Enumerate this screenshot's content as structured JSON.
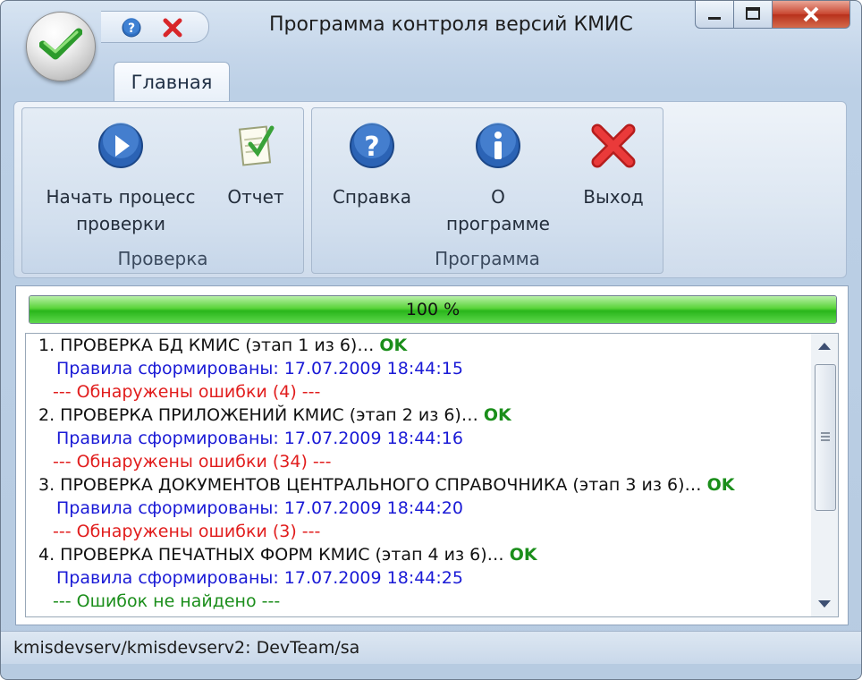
{
  "window": {
    "title": "Программа контроля версий КМИС"
  },
  "ribbon": {
    "tab_label": "Главная",
    "groups": [
      {
        "label": "Проверка",
        "buttons": [
          {
            "label": "Начать процесс\nпроверки",
            "icon": "play-icon"
          },
          {
            "label": "Отчет",
            "icon": "report-icon"
          }
        ]
      },
      {
        "label": "Программа",
        "buttons": [
          {
            "label": "Справка",
            "icon": "help-icon"
          },
          {
            "label": "О\nпрограмме",
            "icon": "info-icon"
          },
          {
            "label": "Выход",
            "icon": "exit-icon"
          }
        ]
      }
    ]
  },
  "progress": {
    "text": "100 %",
    "value": 100
  },
  "log": [
    {
      "type": "heading",
      "text": "1. ПРОВЕРКА БД КМИС (этап 1 из 6)…",
      "status": "OK"
    },
    {
      "type": "rules",
      "text": "Правила сформированы: 17.07.2009 18:44:15"
    },
    {
      "type": "errors",
      "text": "--- Обнаружены ошибки (4) ---"
    },
    {
      "type": "heading",
      "text": "2. ПРОВЕРКА ПРИЛОЖЕНИЙ КМИС (этап 2 из 6)…",
      "status": "OK"
    },
    {
      "type": "rules",
      "text": "Правила сформированы: 17.07.2009 18:44:16"
    },
    {
      "type": "errors",
      "text": "--- Обнаружены ошибки (34) ---"
    },
    {
      "type": "heading",
      "text": "3. ПРОВЕРКА ДОКУМЕНТОВ ЦЕНТРАЛЬНОГО СПРАВОЧНИКА (этап 3 из 6)…",
      "status": "OK"
    },
    {
      "type": "rules",
      "text": "Правила сформированы: 17.07.2009 18:44:20"
    },
    {
      "type": "errors",
      "text": "--- Обнаружены ошибки (3) ---"
    },
    {
      "type": "heading",
      "text": "4. ПРОВЕРКА ПЕЧАТНЫХ ФОРМ КМИС (этап 4 из 6)…",
      "status": "OK"
    },
    {
      "type": "rules",
      "text": "Правила сформированы: 17.07.2009 18:44:25"
    },
    {
      "type": "noerrors",
      "text": "--- Ошибок не найдено ---"
    }
  ],
  "status_bar": {
    "text": "kmisdevserv/kmisdevserv2: DevTeam/sa"
  },
  "colors": {
    "ok": "#1b8e1b",
    "rules": "#1a1ad6",
    "errors": "#e11d1d",
    "progress_fill": "#29b61b"
  }
}
